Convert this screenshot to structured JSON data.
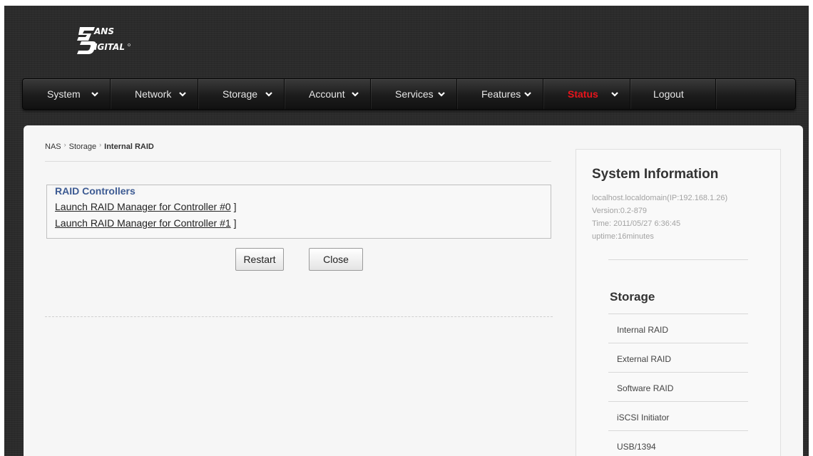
{
  "logo": {
    "text": "SANS DIGITAL"
  },
  "nav": {
    "items": [
      {
        "label": "System",
        "has_dropdown": true
      },
      {
        "label": "Network",
        "has_dropdown": true
      },
      {
        "label": "Storage",
        "has_dropdown": true
      },
      {
        "label": "Account",
        "has_dropdown": true
      },
      {
        "label": "Services",
        "has_dropdown": true
      },
      {
        "label": "Features",
        "has_dropdown": true
      },
      {
        "label": "Status",
        "has_dropdown": true,
        "active": true
      },
      {
        "label": "Logout",
        "has_dropdown": false
      }
    ],
    "active_color": "#e8141b"
  },
  "breadcrumb": [
    "NAS",
    "Storage",
    "Internal RAID"
  ],
  "raid": {
    "legend": "RAID Controllers",
    "links": [
      {
        "label": "Launch RAID Manager for Controller #0",
        "suffix": " ]"
      },
      {
        "label": "Launch RAID Manager for Controller #1",
        "suffix": " ]"
      }
    ]
  },
  "buttons": {
    "restart": "Restart",
    "close": "Close"
  },
  "system_info": {
    "title": "System Information",
    "host": "localhost.localdomain(IP:192.168.1.26)",
    "version": "Version:0.2-879",
    "time": "Time: 2011/05/27 6:36:45",
    "uptime": "uptime:16minutes"
  },
  "storage_menu": {
    "title": "Storage",
    "items": [
      "Internal RAID",
      "External RAID",
      "Software RAID",
      "iSCSI Initiator",
      "USB/1394"
    ]
  },
  "colors": {
    "legend": "#3d5b93",
    "navbar": "#1c1c1c"
  }
}
